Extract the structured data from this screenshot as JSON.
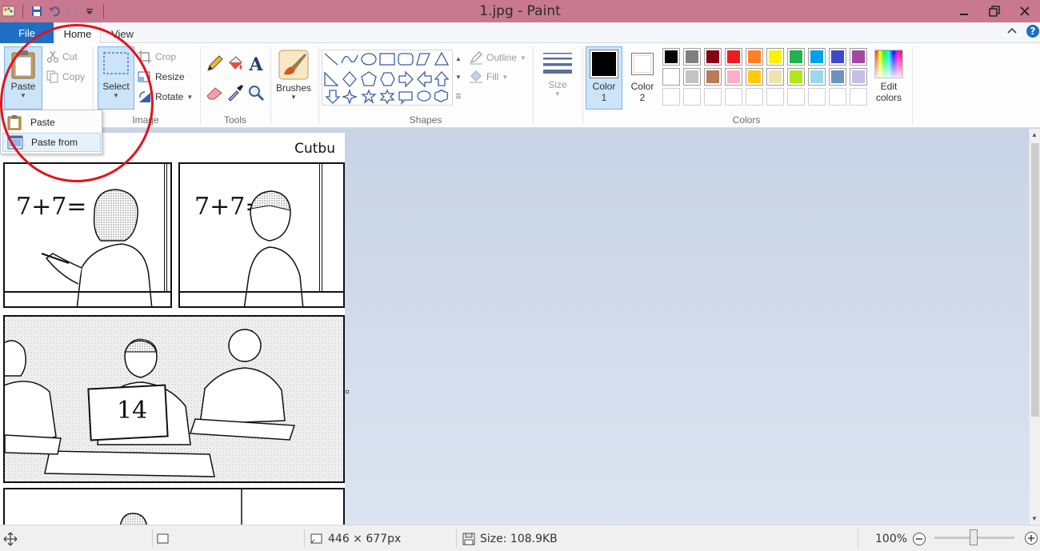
{
  "window": {
    "title": "1.jpg - Paint",
    "accent": "#c8788f"
  },
  "tabs": {
    "file": "File",
    "home": "Home",
    "view": "View"
  },
  "ribbon": {
    "clipboard": {
      "paste": "Paste",
      "cut": "Cut",
      "copy": "Copy"
    },
    "image": {
      "label": "Image",
      "select": "Select",
      "crop": "Crop",
      "resize": "Resize",
      "rotate": "Rotate"
    },
    "tools": {
      "label": "Tools"
    },
    "brushes": {
      "label": "Brushes"
    },
    "shapes": {
      "label": "Shapes",
      "outline": "Outline",
      "fill": "Fill"
    },
    "size": {
      "label": "Size"
    },
    "color1": {
      "line1": "Color",
      "line2": "1",
      "value": "#000000"
    },
    "color2": {
      "line1": "Color",
      "line2": "2",
      "value": "#ffffff"
    },
    "colors": {
      "label": "Colors",
      "row1": [
        "#000000",
        "#7f7f7f",
        "#880015",
        "#ed1c24",
        "#ff7f27",
        "#fff200",
        "#22b14c",
        "#00a2e8",
        "#3f48cc",
        "#a349a4"
      ],
      "row2": [
        "#ffffff",
        "#c3c3c3",
        "#b97a57",
        "#ffaec9",
        "#ffc90e",
        "#efe4b0",
        "#b5e61d",
        "#99d9ea",
        "#7092be",
        "#c8bfe7"
      ]
    },
    "edit_colors": {
      "line1": "Edit",
      "line2": "colors"
    }
  },
  "paste_menu": {
    "items": [
      {
        "label": "Paste",
        "icon": "clipboard-icon"
      },
      {
        "label": "Paste from",
        "icon": "paste-from-icon"
      }
    ]
  },
  "canvas": {
    "comic_watermark": "Cutbu",
    "panel1_text": "7+7=",
    "panel2_text": "7+7=",
    "sign_number": "14"
  },
  "status": {
    "dimensions": "446 × 677px",
    "size": "Size: 108.9KB",
    "zoom": "100%"
  }
}
